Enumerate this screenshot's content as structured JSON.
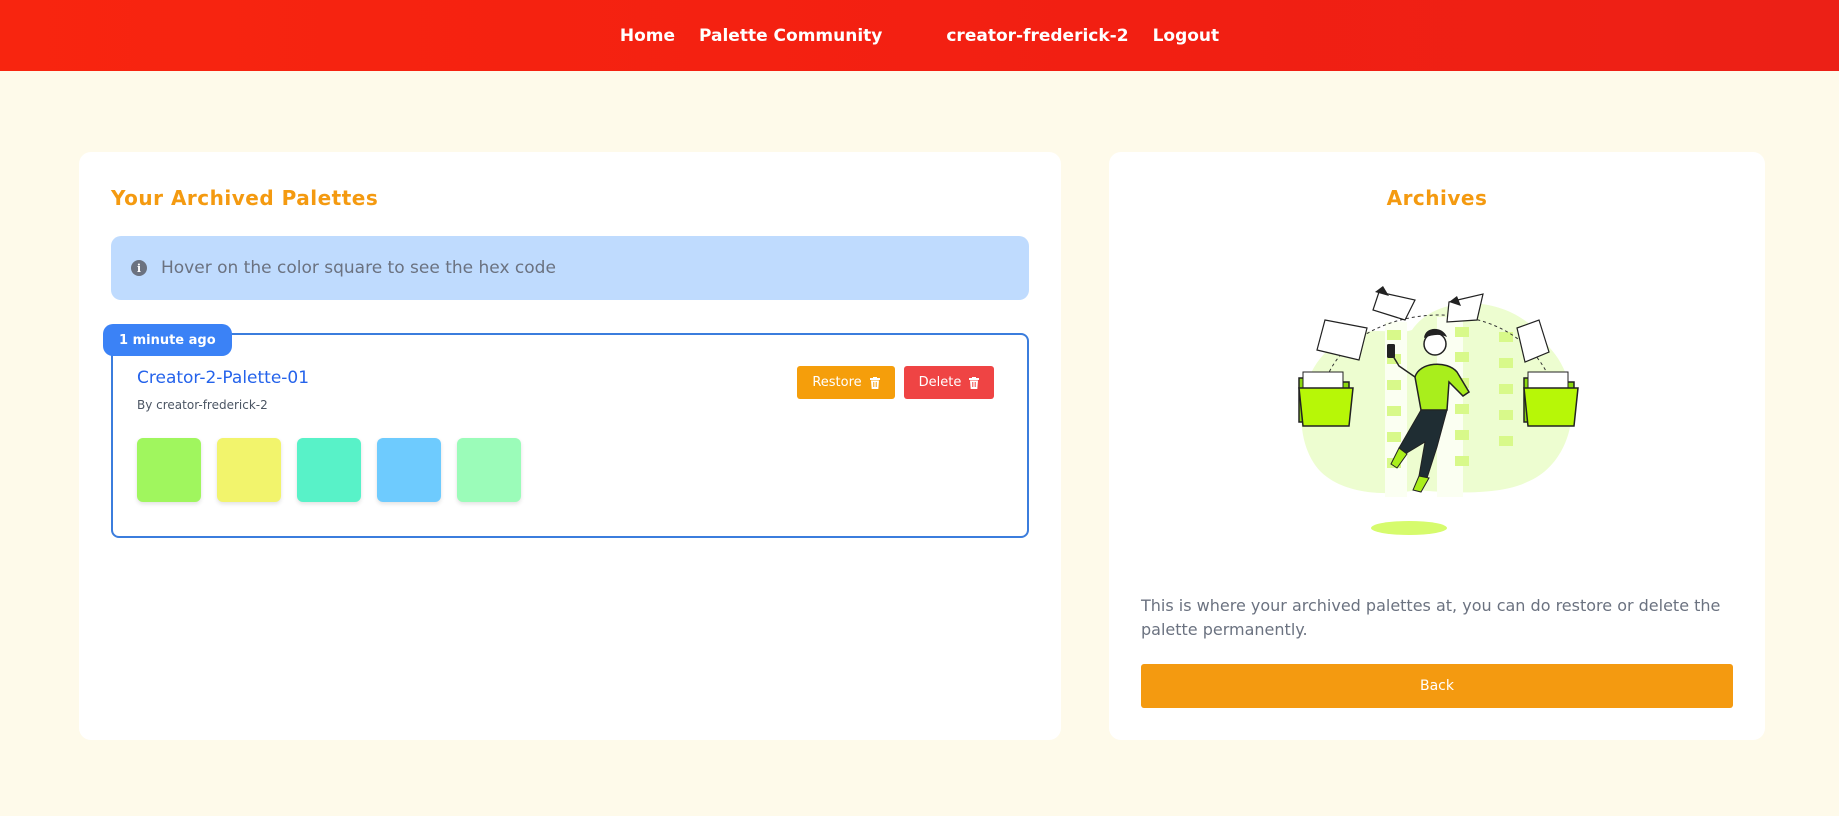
{
  "nav": {
    "home": "Home",
    "community": "Palette Community",
    "user": "creator-frederick-2",
    "logout": "Logout"
  },
  "archived": {
    "title": "Your Archived Palettes",
    "info_text": "Hover on the color square to see the hex code",
    "palette": {
      "time_badge": "1 minute ago",
      "name": "Creator-2-Palette-01",
      "author": "By creator-frederick-2",
      "restore_label": "Restore",
      "delete_label": "Delete",
      "colors": [
        "#a0f65e",
        "#f2f46c",
        "#58f2c8",
        "#6ecbfe",
        "#9bfcb9"
      ]
    }
  },
  "archives_panel": {
    "title": "Archives",
    "description": "This is where your archived palettes at, you can do restore or delete the palette permanently.",
    "back_label": "Back"
  },
  "colors": {
    "header": "#f4220f",
    "accent_orange": "#f49a10",
    "blue": "#3b82f6",
    "danger": "#ef4444",
    "background": "#fefaea"
  }
}
